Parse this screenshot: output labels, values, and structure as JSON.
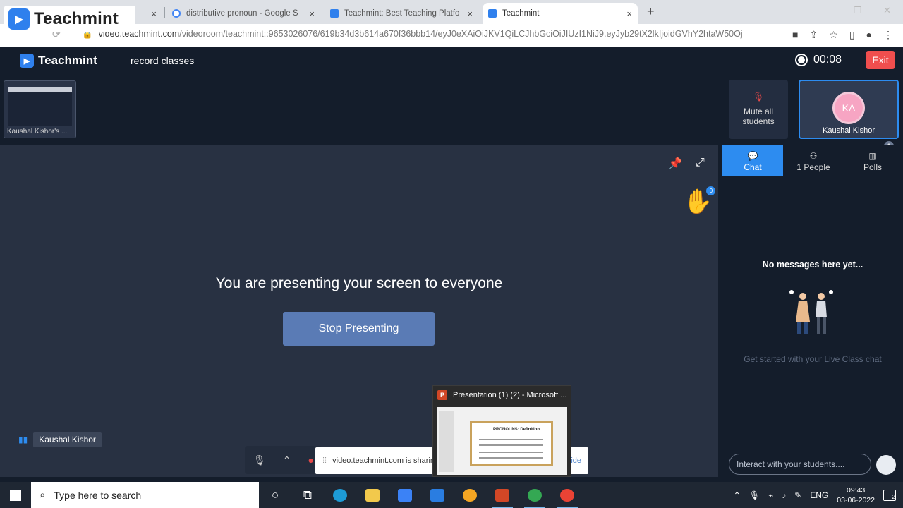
{
  "logo_overlay": {
    "text": "Teachmint"
  },
  "browser": {
    "tabs": [
      {
        "label": "distributive pronoun - Google S",
        "close": "×"
      },
      {
        "label": "Teachmint: Best Teaching Platfo",
        "close": "×"
      },
      {
        "label": "Teachmint",
        "close": "×"
      }
    ],
    "first_tab_close": "×",
    "new_tab": "+",
    "url_host": "video.teachmint.com",
    "url_path": "/videoroom/teachmint::9653026076/619b34d3b614a670f36bbb14/eyJ0eXAiOiJKV1QiLCJhbGciOiJIUzI1NiJ9.eyJyb29tX2lkIjoidGVhY2htaW50Oj"
  },
  "header": {
    "brand": "Teachmint",
    "record_label": "record classes",
    "timer": "00:08",
    "exit_label": "Exit"
  },
  "participants": {
    "screen_thumb_label": "Kaushal Kishor's ...",
    "mute_all_label": "Mute all students",
    "self_initials": "KA",
    "self_name": "Kaushal Kishor"
  },
  "stage": {
    "message": "You are presenting your screen to everyone",
    "stop_button": "Stop Presenting",
    "name_chip": "Kaushal Kishor",
    "hand_badge": "0",
    "share_banner": "video.teachmint.com is sharing your screen.",
    "share_banner_hide": "Hide"
  },
  "ppt_preview": {
    "title": "Presentation (1) (2) - Microsoft ...",
    "slide_title": "PRONOUNS: Definition"
  },
  "right_panel": {
    "tabs": [
      {
        "label": "Chat"
      },
      {
        "label": "1 People"
      },
      {
        "label": "Polls"
      }
    ],
    "empty_title": "No messages here yet...",
    "empty_sub": "Get started with your Live Class chat",
    "input_placeholder": "Interact with your students...."
  },
  "taskbar": {
    "search_placeholder": "Type here to search",
    "language": "ENG",
    "time": "09:43",
    "date": "03-06-2022",
    "notifications": "2"
  },
  "colors": {
    "app_bg": "#141d2b",
    "stage_bg": "#283142",
    "accent_blue": "#2d8cf0",
    "exit_red": "#f04e4e",
    "stop_button": "#5a7bb5"
  }
}
